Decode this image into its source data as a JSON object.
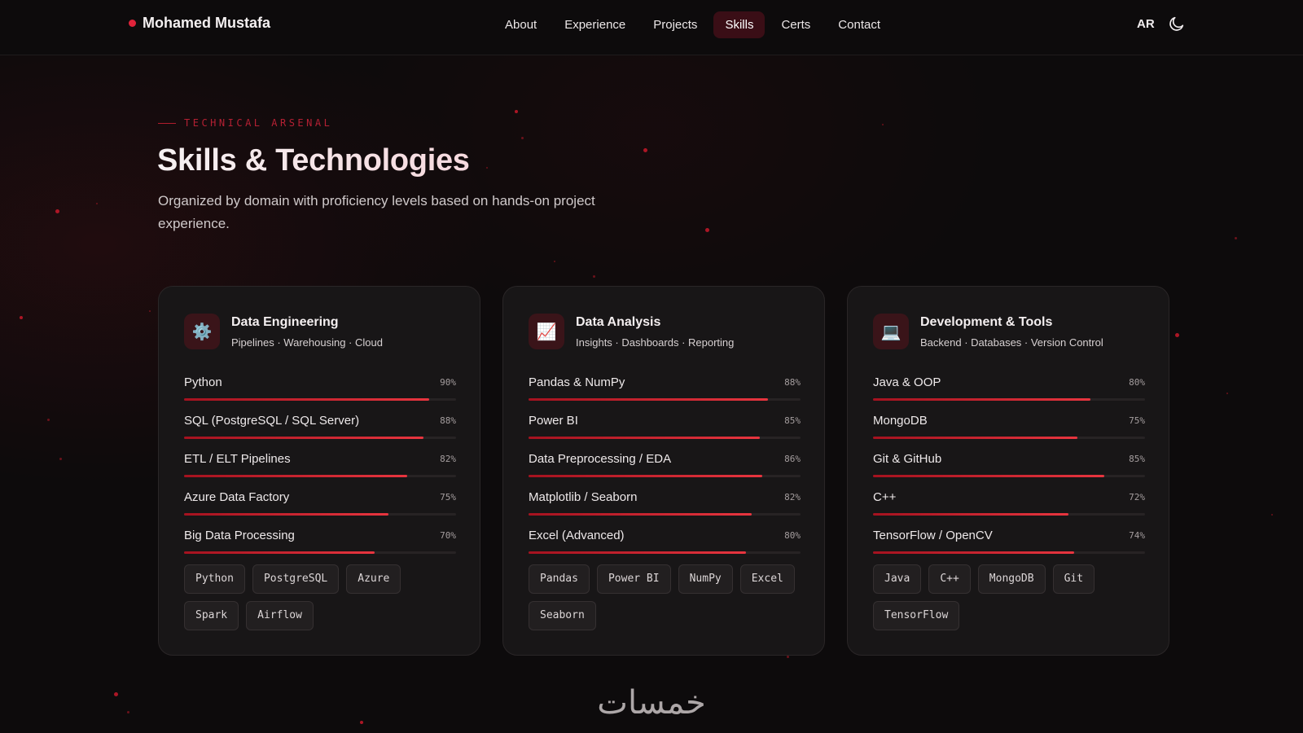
{
  "nav": {
    "brand": "Mohamed Mustafa",
    "links": [
      "About",
      "Experience",
      "Projects",
      "Skills",
      "Certs",
      "Contact"
    ],
    "active": "Skills",
    "lang": "AR",
    "theme_icon": "moon-icon"
  },
  "header": {
    "eyebrow": "TECHNICAL ARSENAL",
    "title": "Skills & Technologies",
    "subtitle": "Organized by domain with proficiency levels based on hands-on project experience."
  },
  "cards": [
    {
      "icon": "⚙️",
      "icon_name": "gear-icon",
      "title": "Data Engineering",
      "subtitle": "Pipelines · Warehousing · Cloud",
      "skills": [
        {
          "name": "Python",
          "pct": "90%",
          "level": 0.9
        },
        {
          "name": "SQL (PostgreSQL / SQL Server)",
          "pct": "88%",
          "level": 0.88
        },
        {
          "name": "ETL / ELT Pipelines",
          "pct": "82%",
          "level": 0.82
        },
        {
          "name": "Azure Data Factory",
          "pct": "75%",
          "level": 0.75
        },
        {
          "name": "Big Data Processing",
          "pct": "70%",
          "level": 0.7
        }
      ],
      "tags": [
        "Python",
        "PostgreSQL",
        "Azure",
        "Spark",
        "Airflow"
      ]
    },
    {
      "icon": "📈",
      "icon_name": "chart-icon",
      "title": "Data Analysis",
      "subtitle": "Insights · Dashboards · Reporting",
      "skills": [
        {
          "name": "Pandas & NumPy",
          "pct": "88%",
          "level": 0.88
        },
        {
          "name": "Power BI",
          "pct": "85%",
          "level": 0.85
        },
        {
          "name": "Data Preprocessing / EDA",
          "pct": "86%",
          "level": 0.86
        },
        {
          "name": "Matplotlib / Seaborn",
          "pct": "82%",
          "level": 0.82
        },
        {
          "name": "Excel (Advanced)",
          "pct": "80%",
          "level": 0.8
        }
      ],
      "tags": [
        "Pandas",
        "Power BI",
        "NumPy",
        "Excel",
        "Seaborn"
      ]
    },
    {
      "icon": "💻",
      "icon_name": "laptop-icon",
      "title": "Development & Tools",
      "subtitle": "Backend · Databases · Version Control",
      "skills": [
        {
          "name": "Java & OOP",
          "pct": "80%",
          "level": 0.8
        },
        {
          "name": "MongoDB",
          "pct": "75%",
          "level": 0.75
        },
        {
          "name": "Git & GitHub",
          "pct": "85%",
          "level": 0.85
        },
        {
          "name": "C++",
          "pct": "72%",
          "level": 0.72
        },
        {
          "name": "TensorFlow / OpenCV",
          "pct": "74%",
          "level": 0.74
        }
      ],
      "tags": [
        "Java",
        "C++",
        "MongoDB",
        "Git",
        "TensorFlow"
      ]
    }
  ],
  "watermark": "خمسات",
  "colors": {
    "accent": "#e0233a",
    "background": "#0d0b0c",
    "card": "#181617"
  }
}
